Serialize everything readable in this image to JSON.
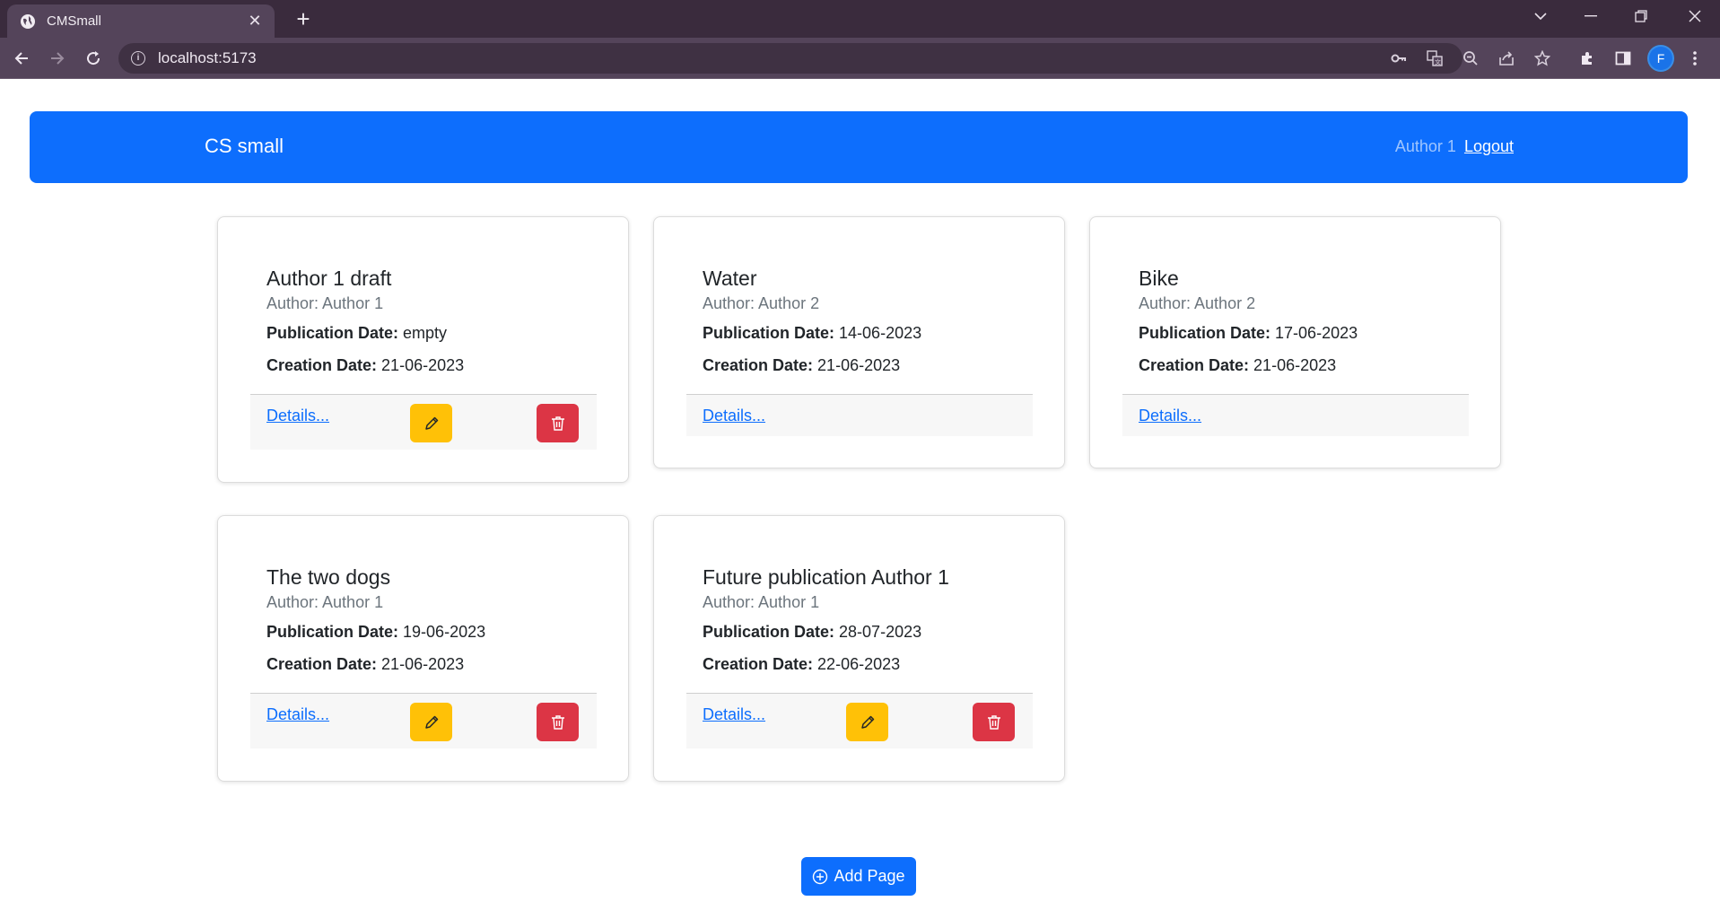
{
  "browser": {
    "tab_title": "CMSmall",
    "url": "localhost:5173",
    "profile_initial": "F"
  },
  "navbar": {
    "brand": "CS small",
    "user_name": "Author 1",
    "logout_label": "Logout"
  },
  "labels": {
    "publication_date": "Publication Date:",
    "creation_date": "Creation Date:",
    "details": "Details..."
  },
  "pages": [
    {
      "title": "Author 1 draft",
      "author": "Author: Author 1",
      "publication_date": "empty",
      "creation_date": "21-06-2023",
      "editable": true
    },
    {
      "title": "Water",
      "author": "Author: Author 2",
      "publication_date": "14-06-2023",
      "creation_date": "21-06-2023",
      "editable": false
    },
    {
      "title": "Bike",
      "author": "Author: Author 2",
      "publication_date": "17-06-2023",
      "creation_date": "21-06-2023",
      "editable": false
    },
    {
      "title": "The two dogs",
      "author": "Author: Author 1",
      "publication_date": "19-06-2023",
      "creation_date": "21-06-2023",
      "editable": true
    },
    {
      "title": "Future publication Author 1",
      "author": "Author: Author 1",
      "publication_date": "28-07-2023",
      "creation_date": "22-06-2023",
      "editable": true
    }
  ],
  "add_page_label": "Add Page",
  "colors": {
    "primary": "#0d6efd",
    "warning": "#ffc107",
    "danger": "#dc3545"
  }
}
